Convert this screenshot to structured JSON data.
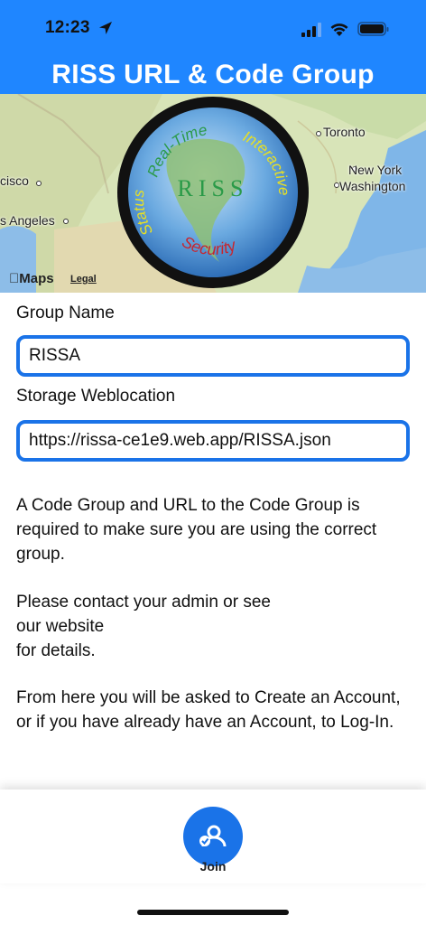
{
  "status_bar": {
    "time": "12:23"
  },
  "header": {
    "title": "RISS URL & Code Group"
  },
  "map": {
    "labels": {
      "san_francisco": "cisco",
      "los_angeles": "s Angeles",
      "toronto": "Toronto",
      "new_york": "New York",
      "washington": "Washington"
    },
    "maps_brand": "Maps",
    "legal": "Legal"
  },
  "logo": {
    "center_text": "RISS",
    "arc_top": "Real-Time",
    "arc_right": "Interactive",
    "arc_left": "Status",
    "arc_bottom": "Security"
  },
  "form": {
    "group_name_label": "Group Name",
    "group_name_value": "RISSA",
    "storage_label": "Storage Weblocation",
    "storage_value": "https://rissa-ce1e9.web.app/RISSA.json"
  },
  "description": {
    "p1": "A Code Group and URL to the Code Group is required to make sure you are using the correct group.",
    "p2_line1": "Please contact your admin or see",
    "p2_line2": "our website",
    "p2_line3": "for details.",
    "p3": "From here you will be asked to Create an Account, or if you have already have an Account, to Log-In."
  },
  "bottom_bar": {
    "join_label": "Join"
  },
  "colors": {
    "header_blue": "#1f86ff",
    "accent_blue": "#1a73e8"
  }
}
